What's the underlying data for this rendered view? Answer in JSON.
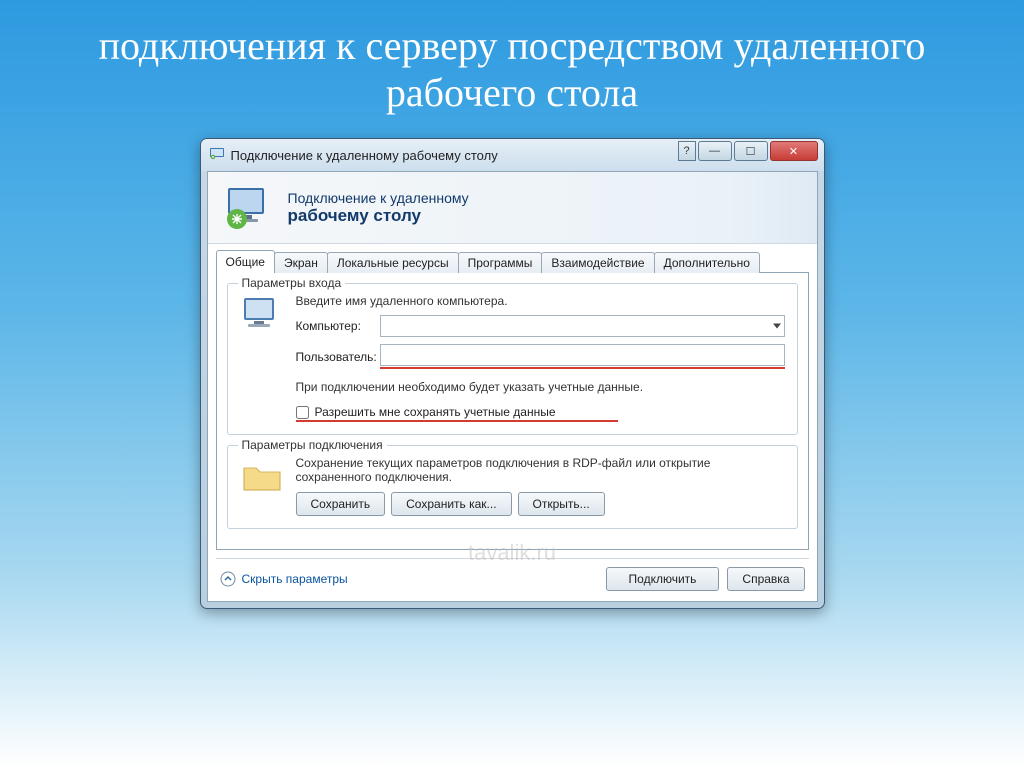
{
  "slide": {
    "title": "подключения к серверу посредством удаленного рабочего стола"
  },
  "window": {
    "title": "Подключение к удаленному рабочему столу",
    "header_line1": "Подключение к удаленному",
    "header_line2": "рабочему столу"
  },
  "tabs": [
    "Общие",
    "Экран",
    "Локальные ресурсы",
    "Программы",
    "Взаимодействие",
    "Дополнительно"
  ],
  "login_group": {
    "legend": "Параметры входа",
    "prompt": "Введите имя удаленного компьютера.",
    "computer_label": "Компьютер:",
    "computer_value": "",
    "user_label": "Пользователь:",
    "user_value": "",
    "hint": "При подключении необходимо будет указать учетные данные.",
    "checkbox": "Разрешить мне сохранять учетные данные"
  },
  "conn_group": {
    "legend": "Параметры подключения",
    "desc": "Сохранение текущих параметров подключения в RDP-файл или открытие сохраненного подключения.",
    "save": "Сохранить",
    "save_as": "Сохранить как...",
    "open": "Открыть..."
  },
  "footer": {
    "hide_params": "Скрыть параметры",
    "connect": "Подключить",
    "help": "Справка"
  },
  "watermark": "tavalik.ru"
}
